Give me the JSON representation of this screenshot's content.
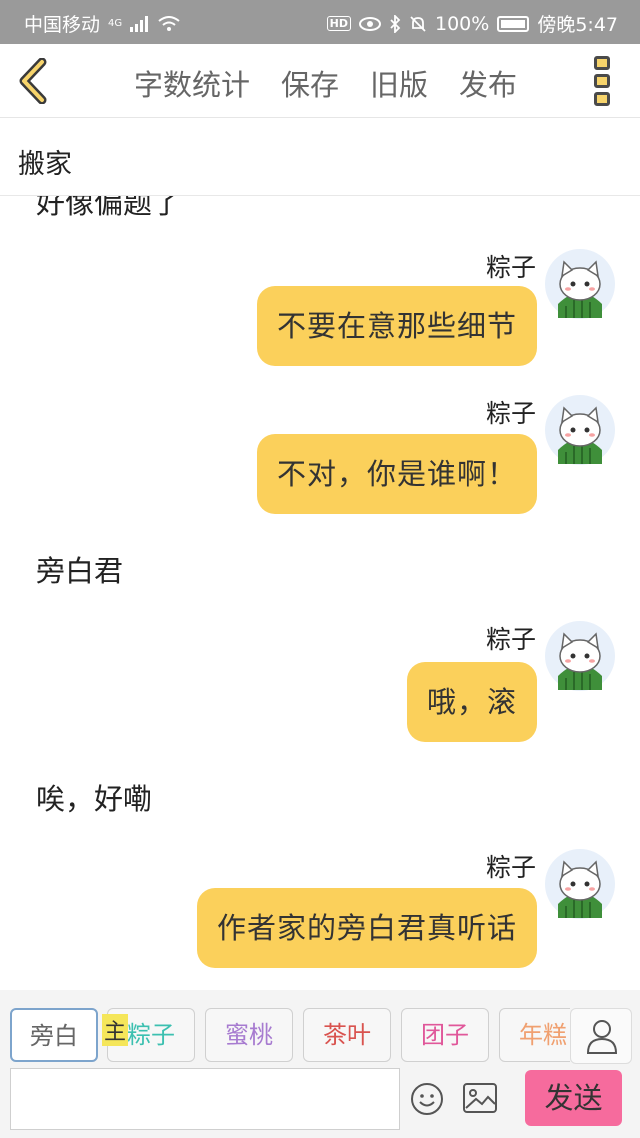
{
  "status_bar": {
    "carrier": "中国移动",
    "network": "4G",
    "hd": "HD",
    "battery": "100%",
    "time": "傍晚5:47"
  },
  "nav": {
    "items": [
      "字数统计",
      "保存",
      "旧版",
      "发布"
    ]
  },
  "title": "搬家",
  "chat": {
    "clipped_text": "好像偏题了",
    "messages": [
      {
        "type": "character",
        "name": "粽子",
        "text": "不要在意那些细节"
      },
      {
        "type": "character",
        "name": "粽子",
        "text": "不对，你是谁啊！"
      },
      {
        "type": "narration",
        "text": "旁白君"
      },
      {
        "type": "character",
        "name": "粽子",
        "text": "哦，滚"
      },
      {
        "type": "narration",
        "text": "唉，好嘞"
      },
      {
        "type": "character",
        "name": "粽子",
        "text": "作者家的旁白君真听话"
      }
    ]
  },
  "roles": {
    "main_tag": "主",
    "items": [
      {
        "label": "旁白",
        "color": "#666666"
      },
      {
        "label": "粽子",
        "color": "#3cc0b0"
      },
      {
        "label": "蜜桃",
        "color": "#a77bd0"
      },
      {
        "label": "茶叶",
        "color": "#d9534f"
      },
      {
        "label": "团子",
        "color": "#e0579a"
      },
      {
        "label": "年糕",
        "color": "#f0a070"
      }
    ]
  },
  "input": {
    "placeholder": "",
    "send_label": "发送"
  },
  "colors": {
    "bubble": "#fbd05b",
    "send": "#f66b9d",
    "accent": "#f7d46b"
  }
}
